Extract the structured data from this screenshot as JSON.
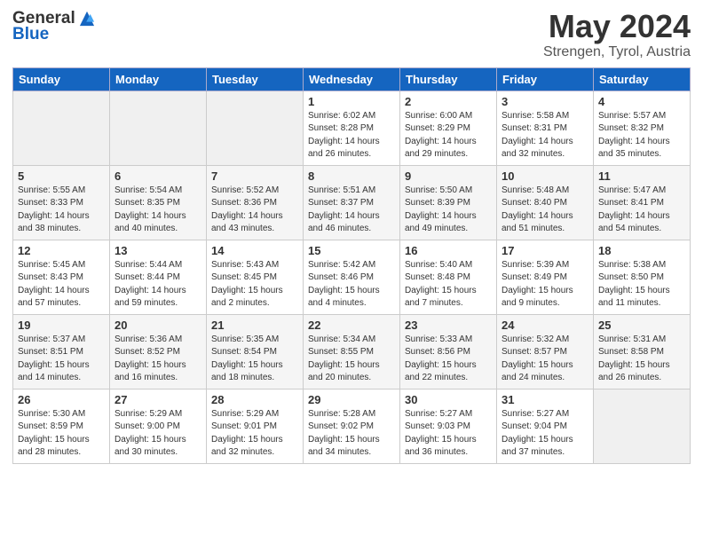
{
  "header": {
    "logo_line1": "General",
    "logo_line2": "Blue",
    "month": "May 2024",
    "location": "Strengen, Tyrol, Austria"
  },
  "days_of_week": [
    "Sunday",
    "Monday",
    "Tuesday",
    "Wednesday",
    "Thursday",
    "Friday",
    "Saturday"
  ],
  "weeks": [
    [
      {
        "day": "",
        "info": ""
      },
      {
        "day": "",
        "info": ""
      },
      {
        "day": "",
        "info": ""
      },
      {
        "day": "1",
        "info": "Sunrise: 6:02 AM\nSunset: 8:28 PM\nDaylight: 14 hours\nand 26 minutes."
      },
      {
        "day": "2",
        "info": "Sunrise: 6:00 AM\nSunset: 8:29 PM\nDaylight: 14 hours\nand 29 minutes."
      },
      {
        "day": "3",
        "info": "Sunrise: 5:58 AM\nSunset: 8:31 PM\nDaylight: 14 hours\nand 32 minutes."
      },
      {
        "day": "4",
        "info": "Sunrise: 5:57 AM\nSunset: 8:32 PM\nDaylight: 14 hours\nand 35 minutes."
      }
    ],
    [
      {
        "day": "5",
        "info": "Sunrise: 5:55 AM\nSunset: 8:33 PM\nDaylight: 14 hours\nand 38 minutes."
      },
      {
        "day": "6",
        "info": "Sunrise: 5:54 AM\nSunset: 8:35 PM\nDaylight: 14 hours\nand 40 minutes."
      },
      {
        "day": "7",
        "info": "Sunrise: 5:52 AM\nSunset: 8:36 PM\nDaylight: 14 hours\nand 43 minutes."
      },
      {
        "day": "8",
        "info": "Sunrise: 5:51 AM\nSunset: 8:37 PM\nDaylight: 14 hours\nand 46 minutes."
      },
      {
        "day": "9",
        "info": "Sunrise: 5:50 AM\nSunset: 8:39 PM\nDaylight: 14 hours\nand 49 minutes."
      },
      {
        "day": "10",
        "info": "Sunrise: 5:48 AM\nSunset: 8:40 PM\nDaylight: 14 hours\nand 51 minutes."
      },
      {
        "day": "11",
        "info": "Sunrise: 5:47 AM\nSunset: 8:41 PM\nDaylight: 14 hours\nand 54 minutes."
      }
    ],
    [
      {
        "day": "12",
        "info": "Sunrise: 5:45 AM\nSunset: 8:43 PM\nDaylight: 14 hours\nand 57 minutes."
      },
      {
        "day": "13",
        "info": "Sunrise: 5:44 AM\nSunset: 8:44 PM\nDaylight: 14 hours\nand 59 minutes."
      },
      {
        "day": "14",
        "info": "Sunrise: 5:43 AM\nSunset: 8:45 PM\nDaylight: 15 hours\nand 2 minutes."
      },
      {
        "day": "15",
        "info": "Sunrise: 5:42 AM\nSunset: 8:46 PM\nDaylight: 15 hours\nand 4 minutes."
      },
      {
        "day": "16",
        "info": "Sunrise: 5:40 AM\nSunset: 8:48 PM\nDaylight: 15 hours\nand 7 minutes."
      },
      {
        "day": "17",
        "info": "Sunrise: 5:39 AM\nSunset: 8:49 PM\nDaylight: 15 hours\nand 9 minutes."
      },
      {
        "day": "18",
        "info": "Sunrise: 5:38 AM\nSunset: 8:50 PM\nDaylight: 15 hours\nand 11 minutes."
      }
    ],
    [
      {
        "day": "19",
        "info": "Sunrise: 5:37 AM\nSunset: 8:51 PM\nDaylight: 15 hours\nand 14 minutes."
      },
      {
        "day": "20",
        "info": "Sunrise: 5:36 AM\nSunset: 8:52 PM\nDaylight: 15 hours\nand 16 minutes."
      },
      {
        "day": "21",
        "info": "Sunrise: 5:35 AM\nSunset: 8:54 PM\nDaylight: 15 hours\nand 18 minutes."
      },
      {
        "day": "22",
        "info": "Sunrise: 5:34 AM\nSunset: 8:55 PM\nDaylight: 15 hours\nand 20 minutes."
      },
      {
        "day": "23",
        "info": "Sunrise: 5:33 AM\nSunset: 8:56 PM\nDaylight: 15 hours\nand 22 minutes."
      },
      {
        "day": "24",
        "info": "Sunrise: 5:32 AM\nSunset: 8:57 PM\nDaylight: 15 hours\nand 24 minutes."
      },
      {
        "day": "25",
        "info": "Sunrise: 5:31 AM\nSunset: 8:58 PM\nDaylight: 15 hours\nand 26 minutes."
      }
    ],
    [
      {
        "day": "26",
        "info": "Sunrise: 5:30 AM\nSunset: 8:59 PM\nDaylight: 15 hours\nand 28 minutes."
      },
      {
        "day": "27",
        "info": "Sunrise: 5:29 AM\nSunset: 9:00 PM\nDaylight: 15 hours\nand 30 minutes."
      },
      {
        "day": "28",
        "info": "Sunrise: 5:29 AM\nSunset: 9:01 PM\nDaylight: 15 hours\nand 32 minutes."
      },
      {
        "day": "29",
        "info": "Sunrise: 5:28 AM\nSunset: 9:02 PM\nDaylight: 15 hours\nand 34 minutes."
      },
      {
        "day": "30",
        "info": "Sunrise: 5:27 AM\nSunset: 9:03 PM\nDaylight: 15 hours\nand 36 minutes."
      },
      {
        "day": "31",
        "info": "Sunrise: 5:27 AM\nSunset: 9:04 PM\nDaylight: 15 hours\nand 37 minutes."
      },
      {
        "day": "",
        "info": ""
      }
    ]
  ]
}
